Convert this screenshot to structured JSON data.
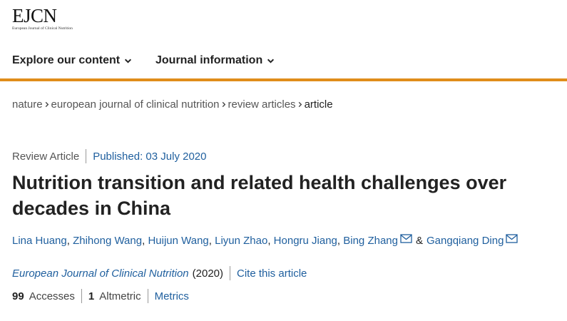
{
  "logo": {
    "name": "EJCN",
    "subtitle": "European Journal of Clinical Nutrition"
  },
  "nav": {
    "items": [
      {
        "label": "Explore our content"
      },
      {
        "label": "Journal information"
      }
    ]
  },
  "breadcrumb": [
    {
      "label": "nature"
    },
    {
      "label": "european journal of clinical nutrition"
    },
    {
      "label": "review articles"
    },
    {
      "label": "article"
    }
  ],
  "article": {
    "type": "Review Article",
    "published": "Published: 03 July 2020",
    "title": "Nutrition transition and related health challenges over decades in China",
    "authors": [
      {
        "name": "Lina Huang",
        "email": false
      },
      {
        "name": "Zhihong Wang",
        "email": false
      },
      {
        "name": "Huijun Wang",
        "email": false
      },
      {
        "name": "Liyun Zhao",
        "email": false
      },
      {
        "name": "Hongru Jiang",
        "email": false
      },
      {
        "name": "Bing Zhang",
        "email": true
      },
      {
        "name": "Gangqiang Ding",
        "email": true
      }
    ],
    "amp": "&",
    "journal": "European Journal of Clinical Nutrition",
    "year": "(2020)",
    "cite": "Cite this article"
  },
  "metrics": {
    "accesses_count": "99",
    "accesses_label": "Accesses",
    "altmetric_count": "1",
    "altmetric_label": "Altmetric",
    "metrics_link": "Metrics"
  },
  "colors": {
    "accent_bar": "#e08d1b",
    "link": "#1f5f9e"
  }
}
